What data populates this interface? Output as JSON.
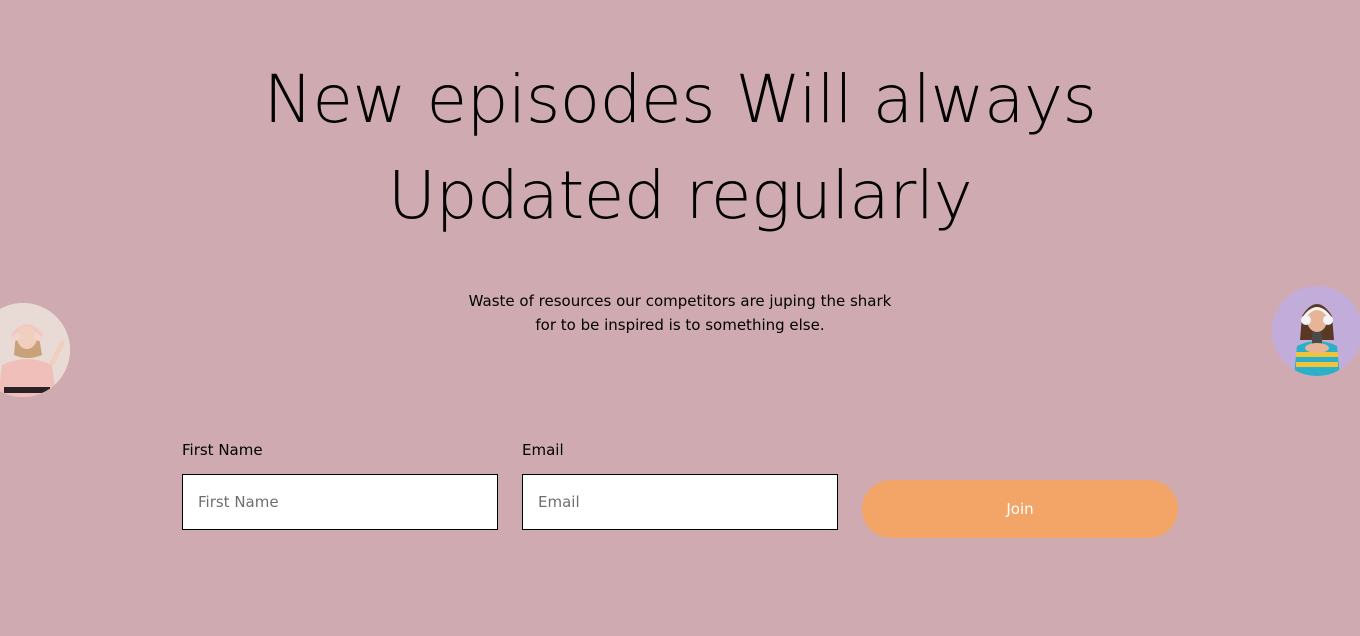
{
  "hero": {
    "headline_line1": "New episodes Will always",
    "headline_line2": "Updated regularly",
    "subtext": "Waste of resources our competitors are juping the shark for to be inspired is to something else."
  },
  "form": {
    "first_name_label": "First Name",
    "first_name_placeholder": "First Name",
    "first_name_value": "",
    "email_label": "Email",
    "email_placeholder": "Email",
    "email_value": "",
    "join_label": "Join"
  },
  "colors": {
    "background": "#cfabb1",
    "button": "#f2a566",
    "button_text": "#ffffff",
    "text": "#000000"
  }
}
